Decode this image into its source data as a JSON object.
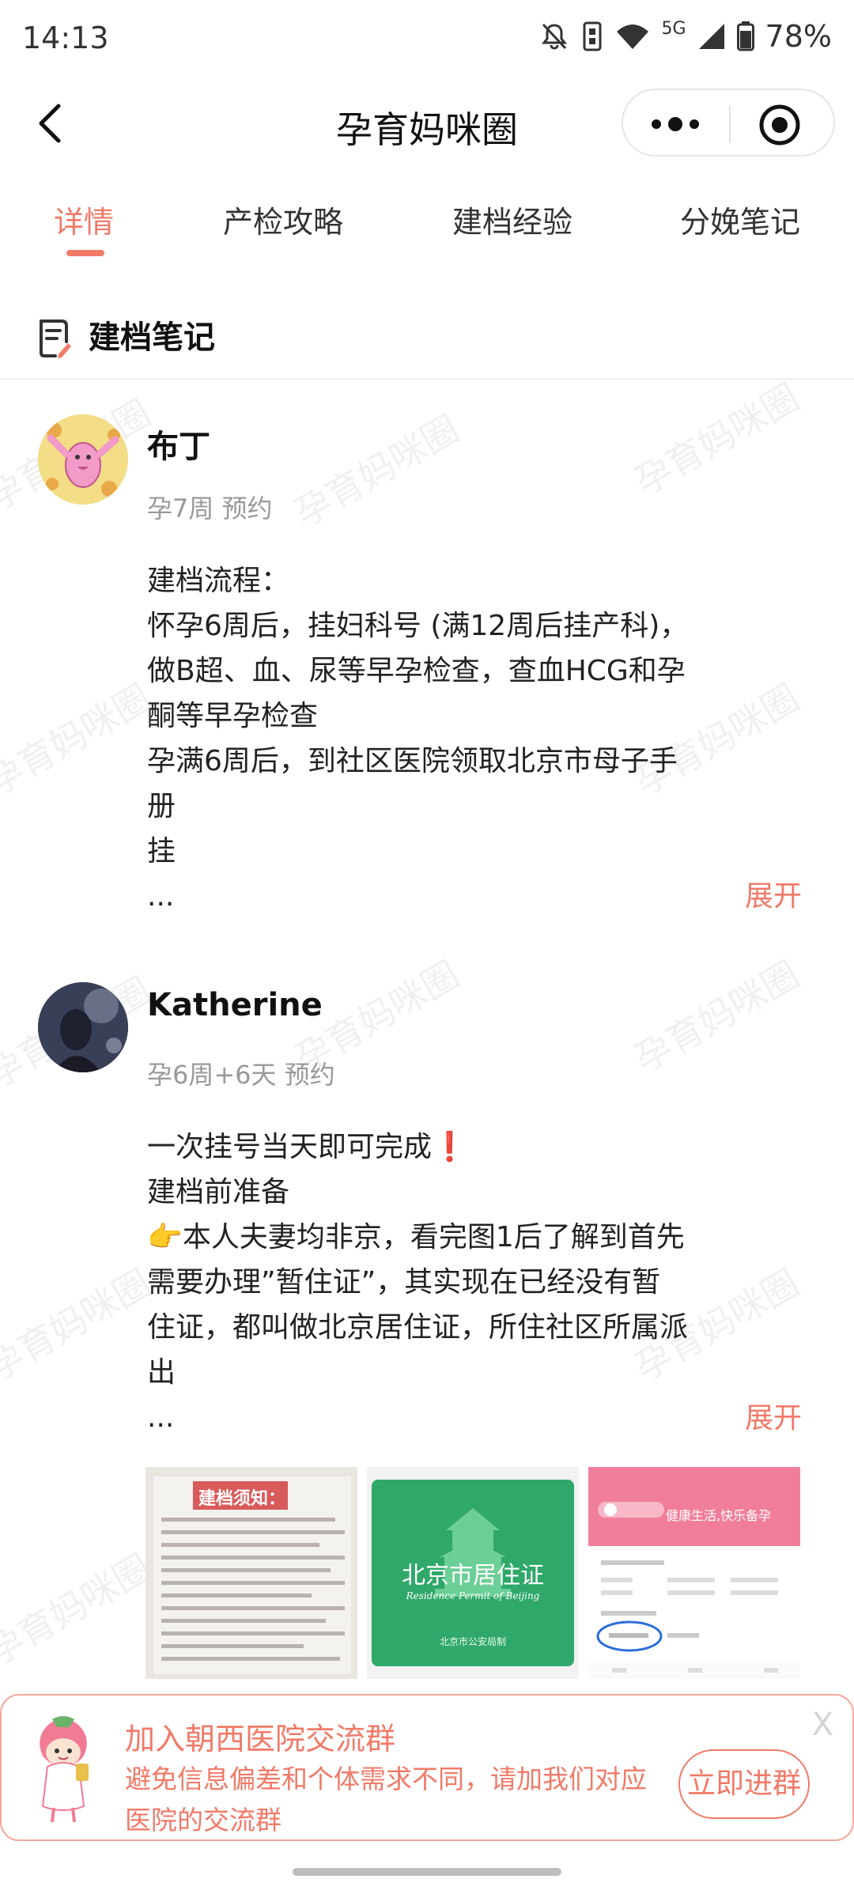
{
  "status_bar": {
    "time": "14:13",
    "network": "5G",
    "battery": "78%"
  },
  "nav": {
    "title": "孕育妈咪圈"
  },
  "tabs": [
    {
      "label": "详情",
      "active": true
    },
    {
      "label": "产检攻略",
      "active": false
    },
    {
      "label": "建档经验",
      "active": false
    },
    {
      "label": "分娩笔记",
      "active": false
    }
  ],
  "section": {
    "title": "建档笔记"
  },
  "watermark_text": "孕育妈咪圈",
  "posts": [
    {
      "author": "布丁",
      "meta": "孕7周 预约",
      "lines": [
        "建档流程：",
        "怀孕6周后，挂妇科号 (满12周后挂产科)，",
        "做B超、血、尿等早孕检查，查血HCG和孕",
        "酮等早孕检查",
        "孕满6周后，到社区医院领取北京市母子手",
        "册",
        "挂",
        "..."
      ],
      "expand_label": "展开"
    },
    {
      "author": "Katherine",
      "meta": "孕6周+6天 预约",
      "lines": [
        "一次挂号当天即可完成❗",
        "建档前准备",
        "👉本人夫妻均非京，看完图1后了解到首先",
        "需要办理”暂住证”，其实现在已经没有暂",
        "住证，都叫做北京居住证，所住社区所属派",
        "出",
        "..."
      ],
      "expand_label": "展开",
      "thumbnails": {
        "notice": {
          "title": "建档须知："
        },
        "permit": {
          "title": "北京市居住证",
          "subtitle": "Residence Permit of Beijing",
          "issuer": "北京市公安局制"
        },
        "app": {
          "banner": "健康生活,快乐备孕"
        }
      }
    }
  ],
  "banner": {
    "title": "加入朝西医院交流群",
    "description": "避免信息偏差和个体需求不同，请加我们对应医院的交流群",
    "button": "立即进群",
    "close": "X"
  }
}
